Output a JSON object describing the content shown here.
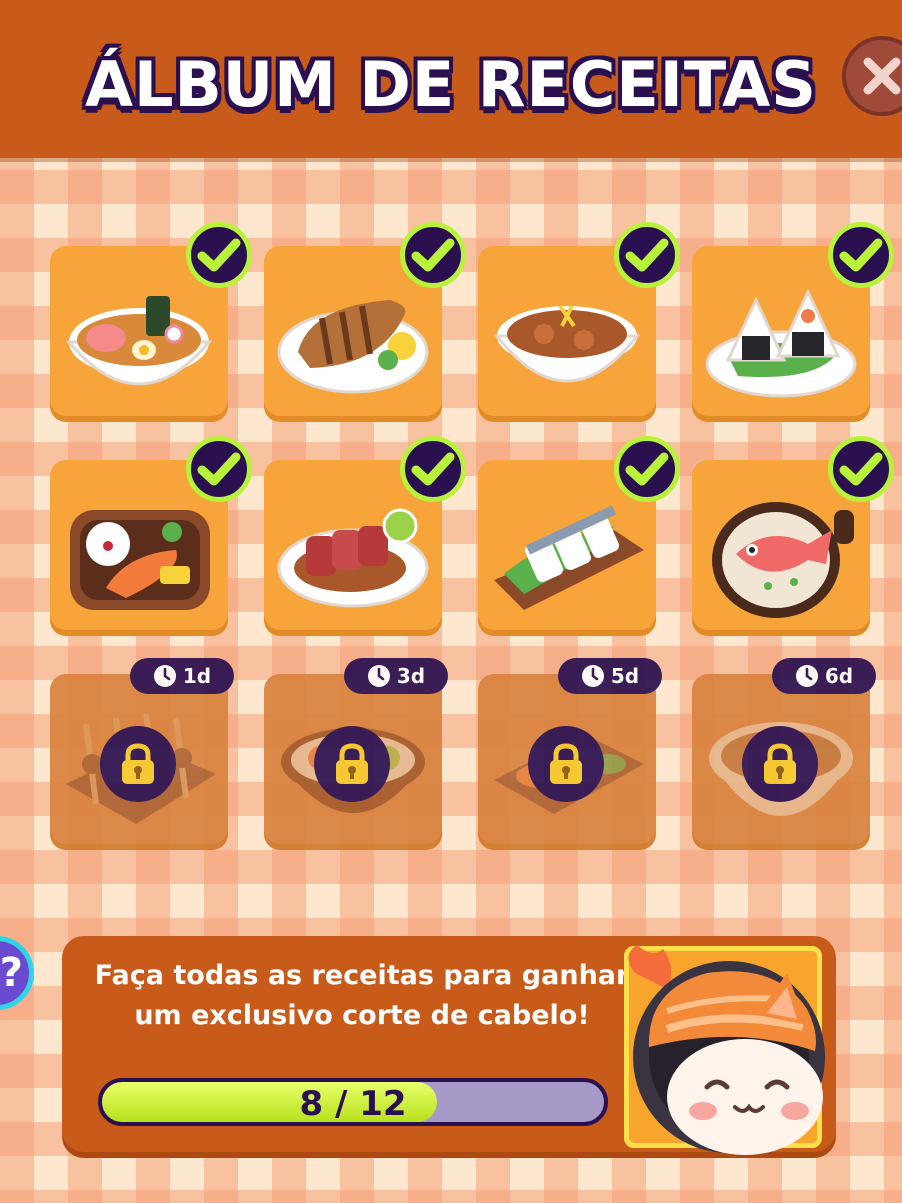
{
  "header": {
    "title": "ÁLBUM DE RECEITAS"
  },
  "colors": {
    "header": "#c95b1a",
    "card": "#f7a43a",
    "check_ring": "#b8f23a",
    "badge": "#2b1050",
    "progress_fill": "#b7e21e",
    "progress_track": "#a89ac8"
  },
  "recipes": [
    {
      "dish": "ramen",
      "unlocked": true
    },
    {
      "dish": "grilled-fish",
      "unlocked": true
    },
    {
      "dish": "curry-bowl",
      "unlocked": true
    },
    {
      "dish": "onigiri",
      "unlocked": true
    },
    {
      "dish": "salmon-bento",
      "unlocked": true
    },
    {
      "dish": "seared-beef",
      "unlocked": true
    },
    {
      "dish": "mackerel-sushi",
      "unlocked": true
    },
    {
      "dish": "sea-bream-rice",
      "unlocked": true
    },
    {
      "dish": "skewers",
      "unlocked": false,
      "timer": "1d"
    },
    {
      "dish": "chirashi-bowl",
      "unlocked": false,
      "timer": "3d"
    },
    {
      "dish": "sushi-platter",
      "unlocked": false,
      "timer": "5d"
    },
    {
      "dish": "soup-bowl",
      "unlocked": false,
      "timer": "6d"
    }
  ],
  "reward": {
    "text": "Faça todas as receitas para ganhar um exclusivo corte de cabelo!",
    "progress_label": "8 / 12",
    "progress_fraction": 0.667
  },
  "help": {
    "label": "?"
  }
}
